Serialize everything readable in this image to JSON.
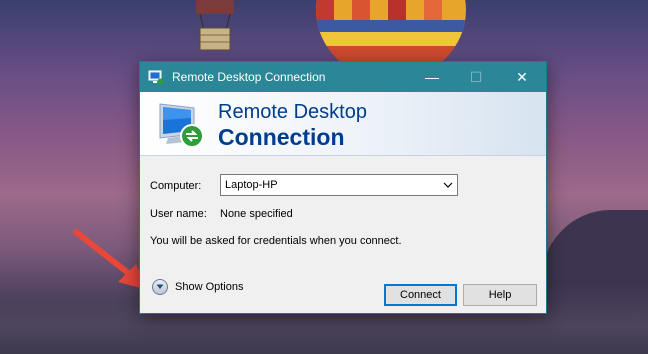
{
  "window": {
    "title": "Remote Desktop Connection",
    "controls": {
      "minimize": "—",
      "maximize": "☐",
      "close": "✕"
    }
  },
  "banner": {
    "line1": "Remote Desktop",
    "line2": "Connection"
  },
  "form": {
    "computer_label": "Computer:",
    "computer_value": "Laptop-HP",
    "username_label": "User name:",
    "username_value": "None specified",
    "info_text": "You will be asked for credentials when you connect."
  },
  "footer": {
    "show_options_label": "Show Options",
    "connect_label": "Connect",
    "help_label": "Help"
  },
  "colors": {
    "titlebar": "#2b8798",
    "banner_text": "#003c8f",
    "arrow": "#e8473a"
  },
  "icons": [
    "remote-desktop-app-icon",
    "remote-desktop-monitor-icon",
    "chevron-down-icon",
    "expand-options-icon",
    "red-arrow-annotation"
  ]
}
